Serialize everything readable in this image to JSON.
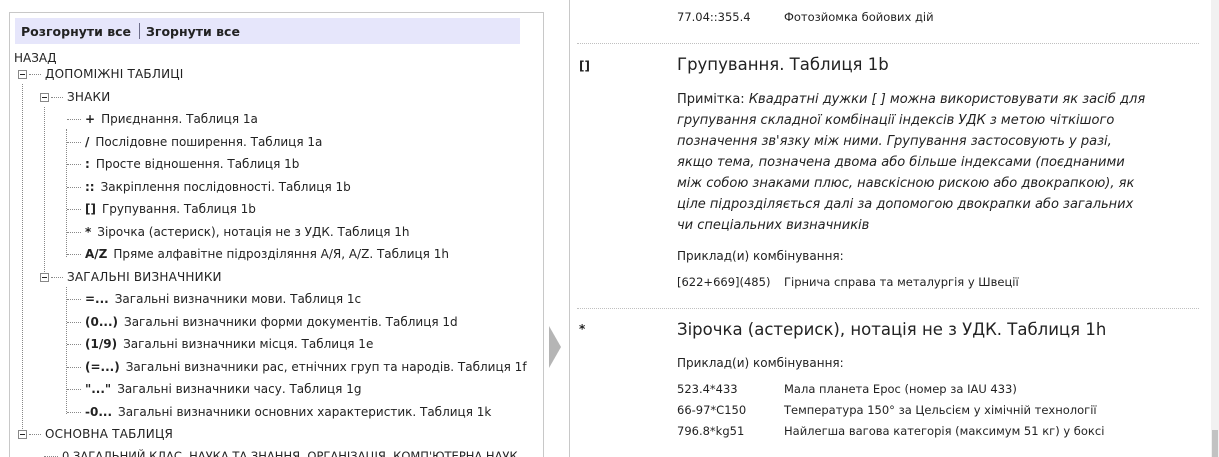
{
  "toolbar": {
    "expand_all": "Розгорнути все",
    "collapse_all": "Згорнути все"
  },
  "tree": {
    "back": "НАЗАД",
    "aux_tables": "ДОПОМІЖНІ ТАБЛИЦІ",
    "signs": "ЗНАКИ",
    "sign_items": [
      {
        "sym": "+",
        "label": "Приєднання. Таблиця 1a"
      },
      {
        "sym": "/",
        "label": "Послідовне поширення. Таблиця 1a"
      },
      {
        "sym": ":",
        "label": "Просте відношення. Таблиця 1b"
      },
      {
        "sym": "::",
        "label": "Закріплення послідовності. Таблиця 1b"
      },
      {
        "sym": "[]",
        "label": "Групування. Таблиця 1b"
      },
      {
        "sym": "*",
        "label": "Зірочка (астериск), нотація не з УДК. Таблиця 1h"
      },
      {
        "sym": "A/Z",
        "label": "Пряме алфавітне підрозділяння А/Я, A/Z. Таблиця 1h"
      }
    ],
    "common": "ЗАГАЛЬНІ ВИЗНАЧНИКИ",
    "common_items": [
      {
        "sym": "=...",
        "label": "Загальні визначники мови. Таблиця 1c"
      },
      {
        "sym": "(0...)",
        "label": "Загальні визначники форми документів. Таблиця 1d"
      },
      {
        "sym": "(1/9)",
        "label": "Загальні визначники місця. Таблиця 1e"
      },
      {
        "sym": "(=...)",
        "label": "Загальні визначники рас, етнічних груп та народів. Таблиця 1f"
      },
      {
        "sym": "\"...\"",
        "label": "Загальні визначники часу. Таблиця 1g"
      },
      {
        "sym": "-0...",
        "label": "Загальні визначники основних характеристик. Таблиця 1k"
      }
    ],
    "main_table": "ОСНОВНА ТАБЛИЦЯ",
    "main_first": "0 ЗАГАЛЬНИЙ КЛАС. НАУКА ТА ЗНАННЯ. ОРГАНІЗАЦІЯ. КОМП'ЮТЕРНА НАУК"
  },
  "detail": {
    "top_example": {
      "code": "77.04::355.4",
      "desc": "Фотозйомка бойових дій"
    },
    "entry1": {
      "sym": "[]",
      "title": "Групування. Таблиця 1b",
      "note_label": "Примітка:",
      "note_text": "Квадратні дужки [ ] можна використовувати як засіб для групування складної комбінації індексів УДК з метою чіткішого позначення зв'язку між ними. Групування застосовують у разі, якщо тема, позначена двома або більше індексами (поєднаними між собою знаками плюс, навскісною рискою або двокрапкою), як ціле підрозділяється далі за допомогою двокрапки або загальних чи спеціальних визначників",
      "examples_label": "Приклад(и) комбінування:",
      "examples": [
        {
          "code": "[622+669](485)",
          "desc": "Гірнича справа та металургія у Швеції"
        }
      ]
    },
    "entry2": {
      "sym": "*",
      "title": "Зірочка (астериск), нотація не з УДК. Таблиця 1h",
      "examples_label": "Приклад(и) комбінування:",
      "examples": [
        {
          "code": "523.4*433",
          "desc": "Мала планета Ерос (номер за IAU 433)"
        },
        {
          "code": "66-97*C150",
          "desc": "Температура 150° за Цельсієм у хімічній технології"
        },
        {
          "code": "796.8*kg51",
          "desc": "Найлегша вагова категорія (максимум 51 кг) у боксі"
        }
      ]
    }
  }
}
